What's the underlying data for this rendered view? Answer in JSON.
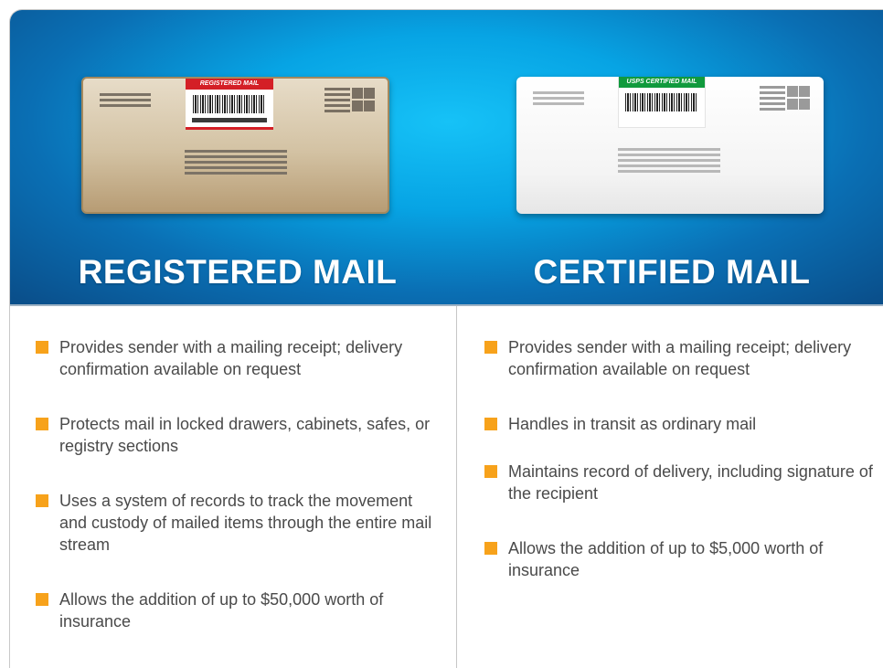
{
  "registered": {
    "heading": "REGISTERED MAIL",
    "label_text": "REGISTERED MAIL",
    "bullets": [
      "Provides sender with a mailing receipt; delivery confirmation available on request",
      "Protects mail in locked drawers, cabinets, safes, or registry sections",
      "Uses a system of records to track the movement and custody of mailed items through the entire mail stream",
      "Allows the addition of up to $50,000 worth of insurance"
    ]
  },
  "certified": {
    "heading": "CERTIFIED MAIL",
    "label_text": "USPS CERTIFIED MAIL",
    "bullets": [
      "Provides sender with a mailing receipt; delivery confirmation available on request",
      "Handles in transit as ordinary mail",
      "Maintains record of delivery, including signature of the recipient",
      "Allows the addition of up to $5,000 worth of insurance"
    ]
  },
  "colors": {
    "banner": "#07a4e4",
    "bullet": "#f7a21b",
    "registered_label": "#d41f26",
    "certified_label": "#109a3d"
  }
}
